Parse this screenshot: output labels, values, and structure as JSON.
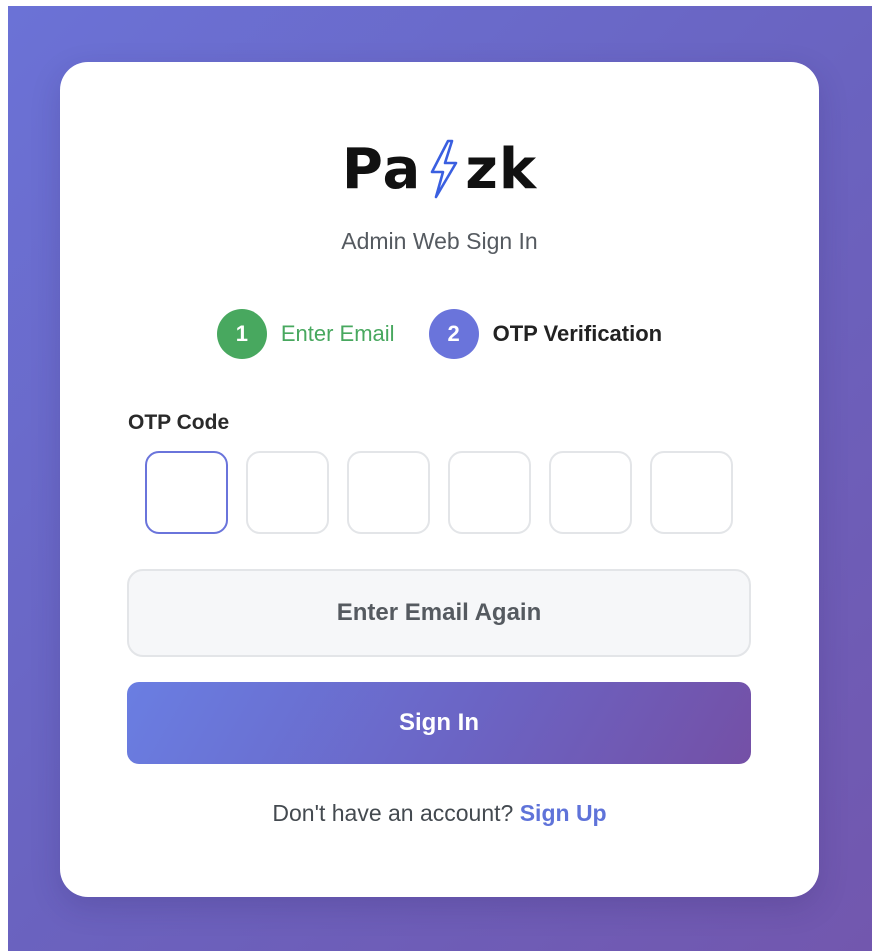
{
  "brand": {
    "logo_prefix": "Pa",
    "logo_suffix": "zk",
    "logo_icon": "lightning-bolt-icon",
    "accent_color": "#6a74db",
    "success_color": "#48a85f"
  },
  "subtitle": "Admin Web Sign In",
  "steps": [
    {
      "number": "1",
      "label": "Enter Email",
      "status": "completed"
    },
    {
      "number": "2",
      "label": "OTP Verification",
      "status": "current"
    }
  ],
  "otp": {
    "label": "OTP Code",
    "digits": [
      "",
      "",
      "",
      "",
      "",
      ""
    ]
  },
  "buttons": {
    "enter_email_again": "Enter Email Again",
    "sign_in": "Sign In"
  },
  "footer": {
    "prompt": "Don't have an account?",
    "link": "Sign Up"
  }
}
